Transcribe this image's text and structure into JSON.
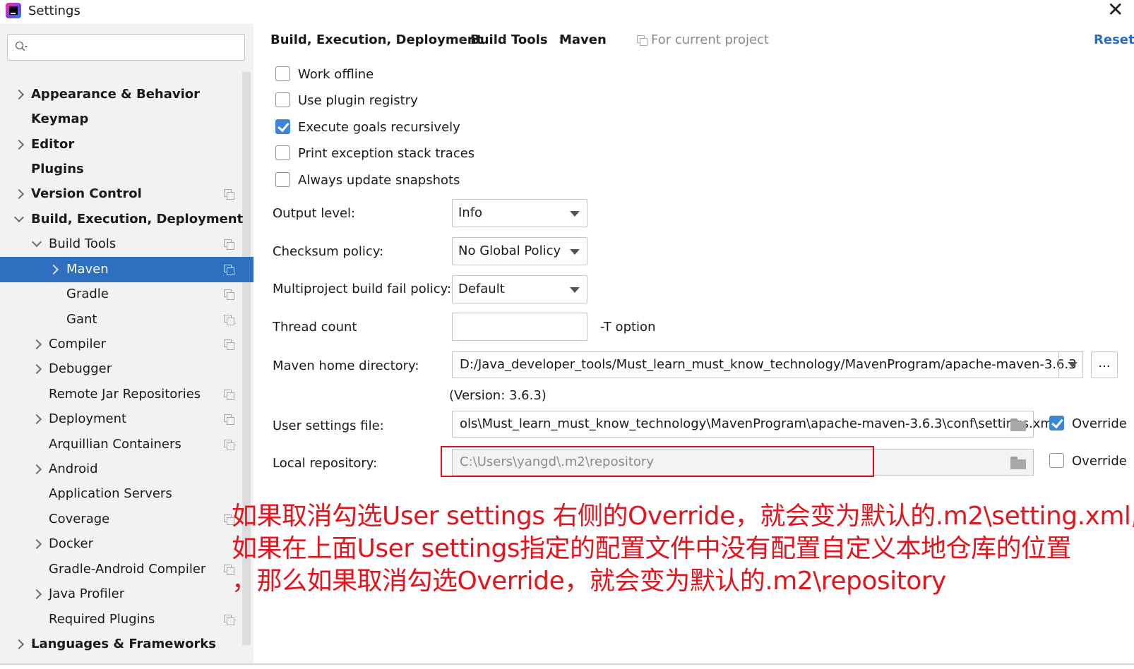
{
  "window": {
    "title": "Settings"
  },
  "search": {
    "placeholder": ""
  },
  "sidebar": {
    "items": [
      {
        "label": "Appearance & Behavior"
      },
      {
        "label": "Keymap"
      },
      {
        "label": "Editor"
      },
      {
        "label": "Plugins"
      },
      {
        "label": "Version Control"
      },
      {
        "label": "Build, Execution, Deployment"
      },
      {
        "label": "Build Tools"
      },
      {
        "label": "Maven"
      },
      {
        "label": "Gradle"
      },
      {
        "label": "Gant"
      },
      {
        "label": "Compiler"
      },
      {
        "label": "Debugger"
      },
      {
        "label": "Remote Jar Repositories"
      },
      {
        "label": "Deployment"
      },
      {
        "label": "Arquillian Containers"
      },
      {
        "label": "Android"
      },
      {
        "label": "Application Servers"
      },
      {
        "label": "Coverage"
      },
      {
        "label": "Docker"
      },
      {
        "label": "Gradle-Android Compiler"
      },
      {
        "label": "Java Profiler"
      },
      {
        "label": "Required Plugins"
      },
      {
        "label": "Languages & Frameworks"
      }
    ]
  },
  "breadcrumb": {
    "items": [
      "Build, Execution, Deployment",
      "Build Tools",
      "Maven"
    ],
    "separator": "›",
    "scope": "For current project"
  },
  "reset_label": "Reset",
  "options": [
    {
      "label": "Work offline",
      "checked": false
    },
    {
      "label": "Use plugin registry",
      "checked": false
    },
    {
      "label": "Execute goals recursively",
      "checked": true
    },
    {
      "label": "Print exception stack traces",
      "checked": false
    },
    {
      "label": "Always update snapshots",
      "checked": false
    }
  ],
  "fields": {
    "output_level": {
      "label": "Output level:",
      "value": "Info"
    },
    "checksum_policy": {
      "label": "Checksum policy:",
      "value": "No Global Policy"
    },
    "fail_policy": {
      "label": "Multiproject build fail policy:",
      "value": "Default"
    },
    "thread_count": {
      "label": "Thread count",
      "value": "",
      "suffix": "-T option"
    },
    "maven_home": {
      "label": "Maven home directory:",
      "value": "D:/Java_developer_tools/Must_learn_must_know_technology/MavenProgram/apache-maven-3.6.3",
      "browse": "...",
      "version": "(Version: 3.6.3)"
    },
    "user_settings": {
      "label": "User settings file:",
      "value": "ols\\Must_learn_must_know_technology\\MavenProgram\\apache-maven-3.6.3\\conf\\settings.xml",
      "override_label": "Override",
      "override_checked": true
    },
    "local_repo": {
      "label": "Local repository:",
      "value": "C:\\Users\\yangd\\.m2\\repository",
      "override_label": "Override",
      "override_checked": false
    }
  },
  "annotation": {
    "line1": "如果取消勾选User settings 右侧的Override，就会变为默认的.m2\\setting.xml,",
    "line2": "如果在上面User settings指定的配置文件中没有配置自定义本地仓库的位置",
    "line3": "，那么如果取消勾选Override，就会变为默认的.m2\\repository",
    "color": "#e3141c"
  },
  "colors": {
    "selection": "#2f6fbf",
    "accent": "#3d85d8",
    "link": "#2a6ec4"
  }
}
